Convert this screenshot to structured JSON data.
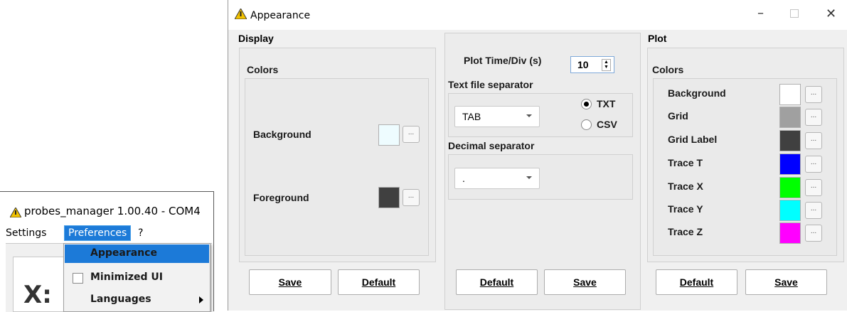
{
  "main_window": {
    "title": "probes_manager 1.00.40 - COM4",
    "menu": {
      "settings": "Settings",
      "preferences": "Preferences",
      "help": "?"
    },
    "axis_label": "X:"
  },
  "preferences_menu": {
    "items": [
      {
        "label": "Appearance"
      },
      {
        "label": "Minimized UI"
      },
      {
        "label": "Languages"
      }
    ]
  },
  "dialog": {
    "title": "Appearance",
    "display": {
      "title": "Display",
      "group_title": "Colors",
      "background_label": "Background",
      "background_color": "#eefcff",
      "foreground_label": "Foreground",
      "foreground_color": "#404040",
      "dots": "...",
      "save_label": "Save",
      "default_label": "Default"
    },
    "middle": {
      "plot_time_label": "Plot Time/Div (s)",
      "plot_time_value": "10",
      "text_sep_label": "Text file separator",
      "text_sep_value": "TAB",
      "txt_label": "TXT",
      "csv_label": "CSV",
      "selected_format": "TXT",
      "decimal_sep_label": "Decimal separator",
      "decimal_sep_value": ".",
      "default_label": "Default",
      "save_label": "Save"
    },
    "plot": {
      "title": "Plot",
      "group_title": "Colors",
      "rows": [
        {
          "label": "Background",
          "color": "#ffffff"
        },
        {
          "label": "Grid",
          "color": "#a0a0a0"
        },
        {
          "label": "Grid Label",
          "color": "#404040"
        },
        {
          "label": "Trace T",
          "color": "#0000ff"
        },
        {
          "label": "Trace X",
          "color": "#00ff00"
        },
        {
          "label": "Trace Y",
          "color": "#00ffff"
        },
        {
          "label": "Trace Z",
          "color": "#ff00ff"
        }
      ],
      "dots": "...",
      "default_label": "Default",
      "save_label": "Save"
    }
  }
}
